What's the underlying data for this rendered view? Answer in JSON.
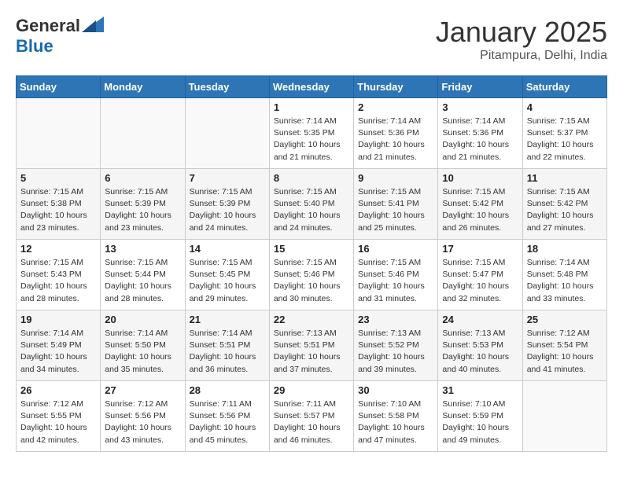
{
  "header": {
    "logo_general": "General",
    "logo_blue": "Blue",
    "month_title": "January 2025",
    "subtitle": "Pitampura, Delhi, India"
  },
  "weekdays": [
    "Sunday",
    "Monday",
    "Tuesday",
    "Wednesday",
    "Thursday",
    "Friday",
    "Saturday"
  ],
  "weeks": [
    [
      {
        "day": "",
        "info": ""
      },
      {
        "day": "",
        "info": ""
      },
      {
        "day": "",
        "info": ""
      },
      {
        "day": "1",
        "info": "Sunrise: 7:14 AM\nSunset: 5:35 PM\nDaylight: 10 hours\nand 21 minutes."
      },
      {
        "day": "2",
        "info": "Sunrise: 7:14 AM\nSunset: 5:36 PM\nDaylight: 10 hours\nand 21 minutes."
      },
      {
        "day": "3",
        "info": "Sunrise: 7:14 AM\nSunset: 5:36 PM\nDaylight: 10 hours\nand 21 minutes."
      },
      {
        "day": "4",
        "info": "Sunrise: 7:15 AM\nSunset: 5:37 PM\nDaylight: 10 hours\nand 22 minutes."
      }
    ],
    [
      {
        "day": "5",
        "info": "Sunrise: 7:15 AM\nSunset: 5:38 PM\nDaylight: 10 hours\nand 23 minutes."
      },
      {
        "day": "6",
        "info": "Sunrise: 7:15 AM\nSunset: 5:39 PM\nDaylight: 10 hours\nand 23 minutes."
      },
      {
        "day": "7",
        "info": "Sunrise: 7:15 AM\nSunset: 5:39 PM\nDaylight: 10 hours\nand 24 minutes."
      },
      {
        "day": "8",
        "info": "Sunrise: 7:15 AM\nSunset: 5:40 PM\nDaylight: 10 hours\nand 24 minutes."
      },
      {
        "day": "9",
        "info": "Sunrise: 7:15 AM\nSunset: 5:41 PM\nDaylight: 10 hours\nand 25 minutes."
      },
      {
        "day": "10",
        "info": "Sunrise: 7:15 AM\nSunset: 5:42 PM\nDaylight: 10 hours\nand 26 minutes."
      },
      {
        "day": "11",
        "info": "Sunrise: 7:15 AM\nSunset: 5:42 PM\nDaylight: 10 hours\nand 27 minutes."
      }
    ],
    [
      {
        "day": "12",
        "info": "Sunrise: 7:15 AM\nSunset: 5:43 PM\nDaylight: 10 hours\nand 28 minutes."
      },
      {
        "day": "13",
        "info": "Sunrise: 7:15 AM\nSunset: 5:44 PM\nDaylight: 10 hours\nand 28 minutes."
      },
      {
        "day": "14",
        "info": "Sunrise: 7:15 AM\nSunset: 5:45 PM\nDaylight: 10 hours\nand 29 minutes."
      },
      {
        "day": "15",
        "info": "Sunrise: 7:15 AM\nSunset: 5:46 PM\nDaylight: 10 hours\nand 30 minutes."
      },
      {
        "day": "16",
        "info": "Sunrise: 7:15 AM\nSunset: 5:46 PM\nDaylight: 10 hours\nand 31 minutes."
      },
      {
        "day": "17",
        "info": "Sunrise: 7:15 AM\nSunset: 5:47 PM\nDaylight: 10 hours\nand 32 minutes."
      },
      {
        "day": "18",
        "info": "Sunrise: 7:14 AM\nSunset: 5:48 PM\nDaylight: 10 hours\nand 33 minutes."
      }
    ],
    [
      {
        "day": "19",
        "info": "Sunrise: 7:14 AM\nSunset: 5:49 PM\nDaylight: 10 hours\nand 34 minutes."
      },
      {
        "day": "20",
        "info": "Sunrise: 7:14 AM\nSunset: 5:50 PM\nDaylight: 10 hours\nand 35 minutes."
      },
      {
        "day": "21",
        "info": "Sunrise: 7:14 AM\nSunset: 5:51 PM\nDaylight: 10 hours\nand 36 minutes."
      },
      {
        "day": "22",
        "info": "Sunrise: 7:13 AM\nSunset: 5:51 PM\nDaylight: 10 hours\nand 37 minutes."
      },
      {
        "day": "23",
        "info": "Sunrise: 7:13 AM\nSunset: 5:52 PM\nDaylight: 10 hours\nand 39 minutes."
      },
      {
        "day": "24",
        "info": "Sunrise: 7:13 AM\nSunset: 5:53 PM\nDaylight: 10 hours\nand 40 minutes."
      },
      {
        "day": "25",
        "info": "Sunrise: 7:12 AM\nSunset: 5:54 PM\nDaylight: 10 hours\nand 41 minutes."
      }
    ],
    [
      {
        "day": "26",
        "info": "Sunrise: 7:12 AM\nSunset: 5:55 PM\nDaylight: 10 hours\nand 42 minutes."
      },
      {
        "day": "27",
        "info": "Sunrise: 7:12 AM\nSunset: 5:56 PM\nDaylight: 10 hours\nand 43 minutes."
      },
      {
        "day": "28",
        "info": "Sunrise: 7:11 AM\nSunset: 5:56 PM\nDaylight: 10 hours\nand 45 minutes."
      },
      {
        "day": "29",
        "info": "Sunrise: 7:11 AM\nSunset: 5:57 PM\nDaylight: 10 hours\nand 46 minutes."
      },
      {
        "day": "30",
        "info": "Sunrise: 7:10 AM\nSunset: 5:58 PM\nDaylight: 10 hours\nand 47 minutes."
      },
      {
        "day": "31",
        "info": "Sunrise: 7:10 AM\nSunset: 5:59 PM\nDaylight: 10 hours\nand 49 minutes."
      },
      {
        "day": "",
        "info": ""
      }
    ]
  ]
}
